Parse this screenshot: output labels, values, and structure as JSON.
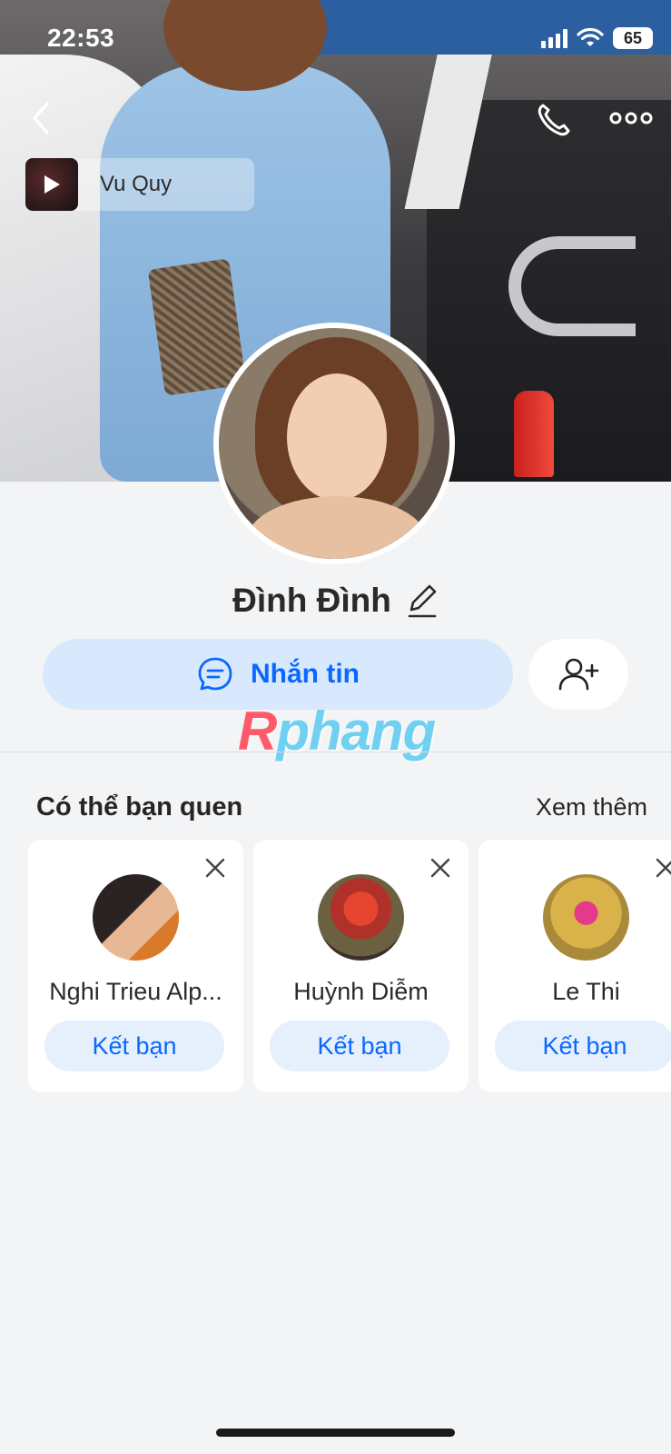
{
  "status_bar": {
    "time": "22:53",
    "battery": "65"
  },
  "music": {
    "title": "Vu Quy"
  },
  "profile": {
    "name": "Đình Đình"
  },
  "actions": {
    "message_label": "Nhắn tin"
  },
  "watermark": {
    "first": "R",
    "rest": "phang"
  },
  "suggestions": {
    "title": "Có thể bạn quen",
    "see_more": "Xem thêm",
    "cards": [
      {
        "name": "Nghi Trieu Alp...",
        "button": "Kết bạn"
      },
      {
        "name": "Huỳnh Diễm",
        "button": "Kết bạn"
      },
      {
        "name": "Le Thi",
        "button": "Kết bạn"
      }
    ]
  },
  "colors": {
    "accent": "#0a68ff",
    "message_bg": "#d9e9fd",
    "card_btn_bg": "#e6f0fd",
    "page_bg": "#f3f4f6"
  }
}
